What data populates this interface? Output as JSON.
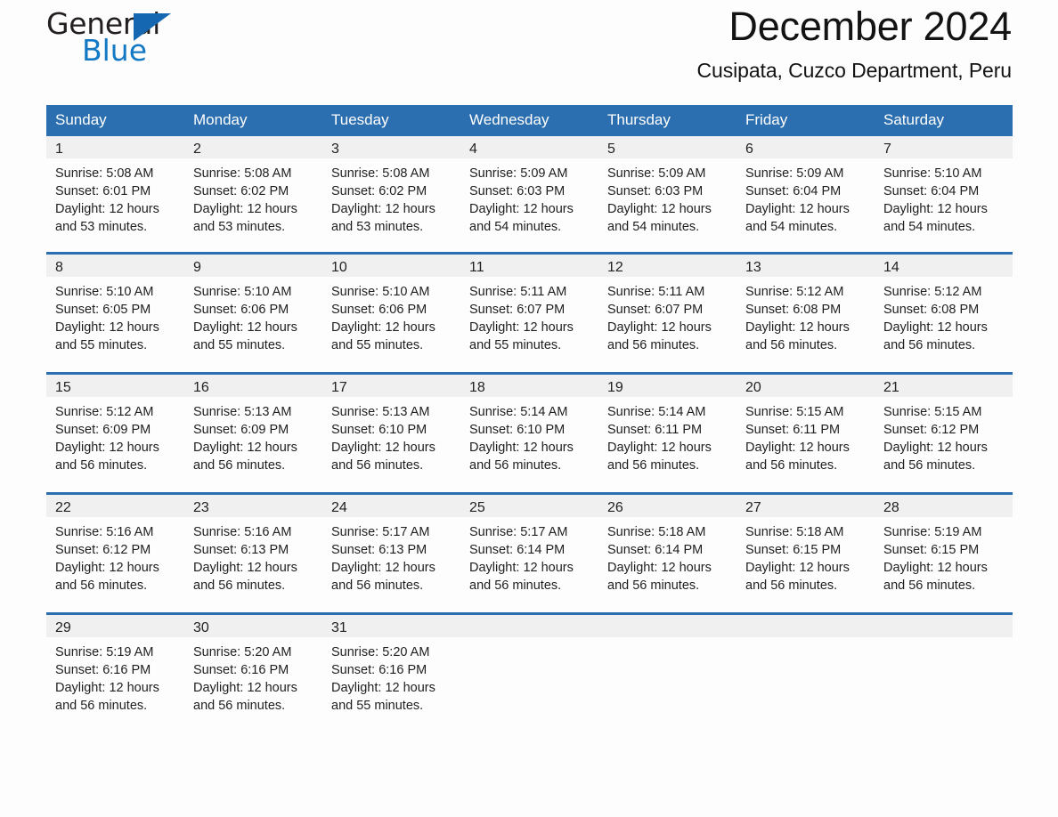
{
  "brand": {
    "name_part1": "General",
    "name_part2": "Blue",
    "triangle_icon": "triangle-icon",
    "accent_color": "#1479c4",
    "header_color": "#2c6fb1"
  },
  "header": {
    "title": "December 2024",
    "subtitle": "Cusipata, Cuzco Department, Peru"
  },
  "calendar": {
    "weekday_headers": [
      "Sunday",
      "Monday",
      "Tuesday",
      "Wednesday",
      "Thursday",
      "Friday",
      "Saturday"
    ],
    "weeks": [
      [
        {
          "day": "1",
          "sunrise": "Sunrise: 5:08 AM",
          "sunset": "Sunset: 6:01 PM",
          "daylight_1": "Daylight: 12 hours",
          "daylight_2": "and 53 minutes."
        },
        {
          "day": "2",
          "sunrise": "Sunrise: 5:08 AM",
          "sunset": "Sunset: 6:02 PM",
          "daylight_1": "Daylight: 12 hours",
          "daylight_2": "and 53 minutes."
        },
        {
          "day": "3",
          "sunrise": "Sunrise: 5:08 AM",
          "sunset": "Sunset: 6:02 PM",
          "daylight_1": "Daylight: 12 hours",
          "daylight_2": "and 53 minutes."
        },
        {
          "day": "4",
          "sunrise": "Sunrise: 5:09 AM",
          "sunset": "Sunset: 6:03 PM",
          "daylight_1": "Daylight: 12 hours",
          "daylight_2": "and 54 minutes."
        },
        {
          "day": "5",
          "sunrise": "Sunrise: 5:09 AM",
          "sunset": "Sunset: 6:03 PM",
          "daylight_1": "Daylight: 12 hours",
          "daylight_2": "and 54 minutes."
        },
        {
          "day": "6",
          "sunrise": "Sunrise: 5:09 AM",
          "sunset": "Sunset: 6:04 PM",
          "daylight_1": "Daylight: 12 hours",
          "daylight_2": "and 54 minutes."
        },
        {
          "day": "7",
          "sunrise": "Sunrise: 5:10 AM",
          "sunset": "Sunset: 6:04 PM",
          "daylight_1": "Daylight: 12 hours",
          "daylight_2": "and 54 minutes."
        }
      ],
      [
        {
          "day": "8",
          "sunrise": "Sunrise: 5:10 AM",
          "sunset": "Sunset: 6:05 PM",
          "daylight_1": "Daylight: 12 hours",
          "daylight_2": "and 55 minutes."
        },
        {
          "day": "9",
          "sunrise": "Sunrise: 5:10 AM",
          "sunset": "Sunset: 6:06 PM",
          "daylight_1": "Daylight: 12 hours",
          "daylight_2": "and 55 minutes."
        },
        {
          "day": "10",
          "sunrise": "Sunrise: 5:10 AM",
          "sunset": "Sunset: 6:06 PM",
          "daylight_1": "Daylight: 12 hours",
          "daylight_2": "and 55 minutes."
        },
        {
          "day": "11",
          "sunrise": "Sunrise: 5:11 AM",
          "sunset": "Sunset: 6:07 PM",
          "daylight_1": "Daylight: 12 hours",
          "daylight_2": "and 55 minutes."
        },
        {
          "day": "12",
          "sunrise": "Sunrise: 5:11 AM",
          "sunset": "Sunset: 6:07 PM",
          "daylight_1": "Daylight: 12 hours",
          "daylight_2": "and 56 minutes."
        },
        {
          "day": "13",
          "sunrise": "Sunrise: 5:12 AM",
          "sunset": "Sunset: 6:08 PM",
          "daylight_1": "Daylight: 12 hours",
          "daylight_2": "and 56 minutes."
        },
        {
          "day": "14",
          "sunrise": "Sunrise: 5:12 AM",
          "sunset": "Sunset: 6:08 PM",
          "daylight_1": "Daylight: 12 hours",
          "daylight_2": "and 56 minutes."
        }
      ],
      [
        {
          "day": "15",
          "sunrise": "Sunrise: 5:12 AM",
          "sunset": "Sunset: 6:09 PM",
          "daylight_1": "Daylight: 12 hours",
          "daylight_2": "and 56 minutes."
        },
        {
          "day": "16",
          "sunrise": "Sunrise: 5:13 AM",
          "sunset": "Sunset: 6:09 PM",
          "daylight_1": "Daylight: 12 hours",
          "daylight_2": "and 56 minutes."
        },
        {
          "day": "17",
          "sunrise": "Sunrise: 5:13 AM",
          "sunset": "Sunset: 6:10 PM",
          "daylight_1": "Daylight: 12 hours",
          "daylight_2": "and 56 minutes."
        },
        {
          "day": "18",
          "sunrise": "Sunrise: 5:14 AM",
          "sunset": "Sunset: 6:10 PM",
          "daylight_1": "Daylight: 12 hours",
          "daylight_2": "and 56 minutes."
        },
        {
          "day": "19",
          "sunrise": "Sunrise: 5:14 AM",
          "sunset": "Sunset: 6:11 PM",
          "daylight_1": "Daylight: 12 hours",
          "daylight_2": "and 56 minutes."
        },
        {
          "day": "20",
          "sunrise": "Sunrise: 5:15 AM",
          "sunset": "Sunset: 6:11 PM",
          "daylight_1": "Daylight: 12 hours",
          "daylight_2": "and 56 minutes."
        },
        {
          "day": "21",
          "sunrise": "Sunrise: 5:15 AM",
          "sunset": "Sunset: 6:12 PM",
          "daylight_1": "Daylight: 12 hours",
          "daylight_2": "and 56 minutes."
        }
      ],
      [
        {
          "day": "22",
          "sunrise": "Sunrise: 5:16 AM",
          "sunset": "Sunset: 6:12 PM",
          "daylight_1": "Daylight: 12 hours",
          "daylight_2": "and 56 minutes."
        },
        {
          "day": "23",
          "sunrise": "Sunrise: 5:16 AM",
          "sunset": "Sunset: 6:13 PM",
          "daylight_1": "Daylight: 12 hours",
          "daylight_2": "and 56 minutes."
        },
        {
          "day": "24",
          "sunrise": "Sunrise: 5:17 AM",
          "sunset": "Sunset: 6:13 PM",
          "daylight_1": "Daylight: 12 hours",
          "daylight_2": "and 56 minutes."
        },
        {
          "day": "25",
          "sunrise": "Sunrise: 5:17 AM",
          "sunset": "Sunset: 6:14 PM",
          "daylight_1": "Daylight: 12 hours",
          "daylight_2": "and 56 minutes."
        },
        {
          "day": "26",
          "sunrise": "Sunrise: 5:18 AM",
          "sunset": "Sunset: 6:14 PM",
          "daylight_1": "Daylight: 12 hours",
          "daylight_2": "and 56 minutes."
        },
        {
          "day": "27",
          "sunrise": "Sunrise: 5:18 AM",
          "sunset": "Sunset: 6:15 PM",
          "daylight_1": "Daylight: 12 hours",
          "daylight_2": "and 56 minutes."
        },
        {
          "day": "28",
          "sunrise": "Sunrise: 5:19 AM",
          "sunset": "Sunset: 6:15 PM",
          "daylight_1": "Daylight: 12 hours",
          "daylight_2": "and 56 minutes."
        }
      ],
      [
        {
          "day": "29",
          "sunrise": "Sunrise: 5:19 AM",
          "sunset": "Sunset: 6:16 PM",
          "daylight_1": "Daylight: 12 hours",
          "daylight_2": "and 56 minutes."
        },
        {
          "day": "30",
          "sunrise": "Sunrise: 5:20 AM",
          "sunset": "Sunset: 6:16 PM",
          "daylight_1": "Daylight: 12 hours",
          "daylight_2": "and 56 minutes."
        },
        {
          "day": "31",
          "sunrise": "Sunrise: 5:20 AM",
          "sunset": "Sunset: 6:16 PM",
          "daylight_1": "Daylight: 12 hours",
          "daylight_2": "and 55 minutes."
        },
        {
          "day": "",
          "sunrise": "",
          "sunset": "",
          "daylight_1": "",
          "daylight_2": ""
        },
        {
          "day": "",
          "sunrise": "",
          "sunset": "",
          "daylight_1": "",
          "daylight_2": ""
        },
        {
          "day": "",
          "sunrise": "",
          "sunset": "",
          "daylight_1": "",
          "daylight_2": ""
        },
        {
          "day": "",
          "sunrise": "",
          "sunset": "",
          "daylight_1": "",
          "daylight_2": ""
        }
      ]
    ]
  }
}
